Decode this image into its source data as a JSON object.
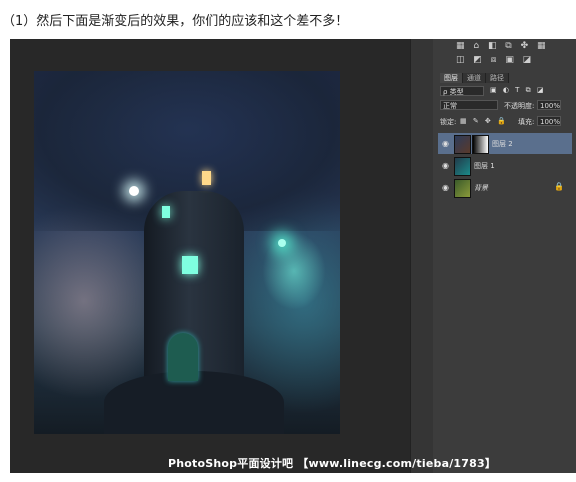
{
  "caption": "（1）然后下面是渐变后的效果，你们的应该和这个差不多！",
  "watermark": "PhotoShop平面设计吧 【www.linecg.com/tieba/1783】",
  "toolbar_icons": {
    "row1": "▦ ⌂ ◧ ⧉ ✤ ▦",
    "row2": "◫ ◩ ⧈ ▣ ◪"
  },
  "layers_panel": {
    "tabs": [
      "图层",
      "通道",
      "路径"
    ],
    "active_tab": "图层",
    "filter": {
      "label": "ρ 类型",
      "icons": "▣ ◐ T ⧉ ◪"
    },
    "blend_mode": "正常",
    "opacity_label": "不透明度:",
    "opacity_value": "100%",
    "lock_label": "锁定:",
    "lock_icons": "▦ ✎ ✥ 🔒",
    "fill_label": "填充:",
    "fill_value": "100%",
    "layers": [
      {
        "name": "图层 2",
        "visible": true,
        "selected": true,
        "has_mask": true
      },
      {
        "name": "图层 1",
        "visible": true,
        "selected": false,
        "has_mask": false
      },
      {
        "name": "背景",
        "visible": true,
        "selected": false,
        "locked": true
      }
    ]
  },
  "colors": {
    "panel_bg": "#3c3c3c",
    "selected_layer": "#5a6f8d",
    "canvas_bg": "#282828",
    "window_glow": "#7fffe0"
  }
}
